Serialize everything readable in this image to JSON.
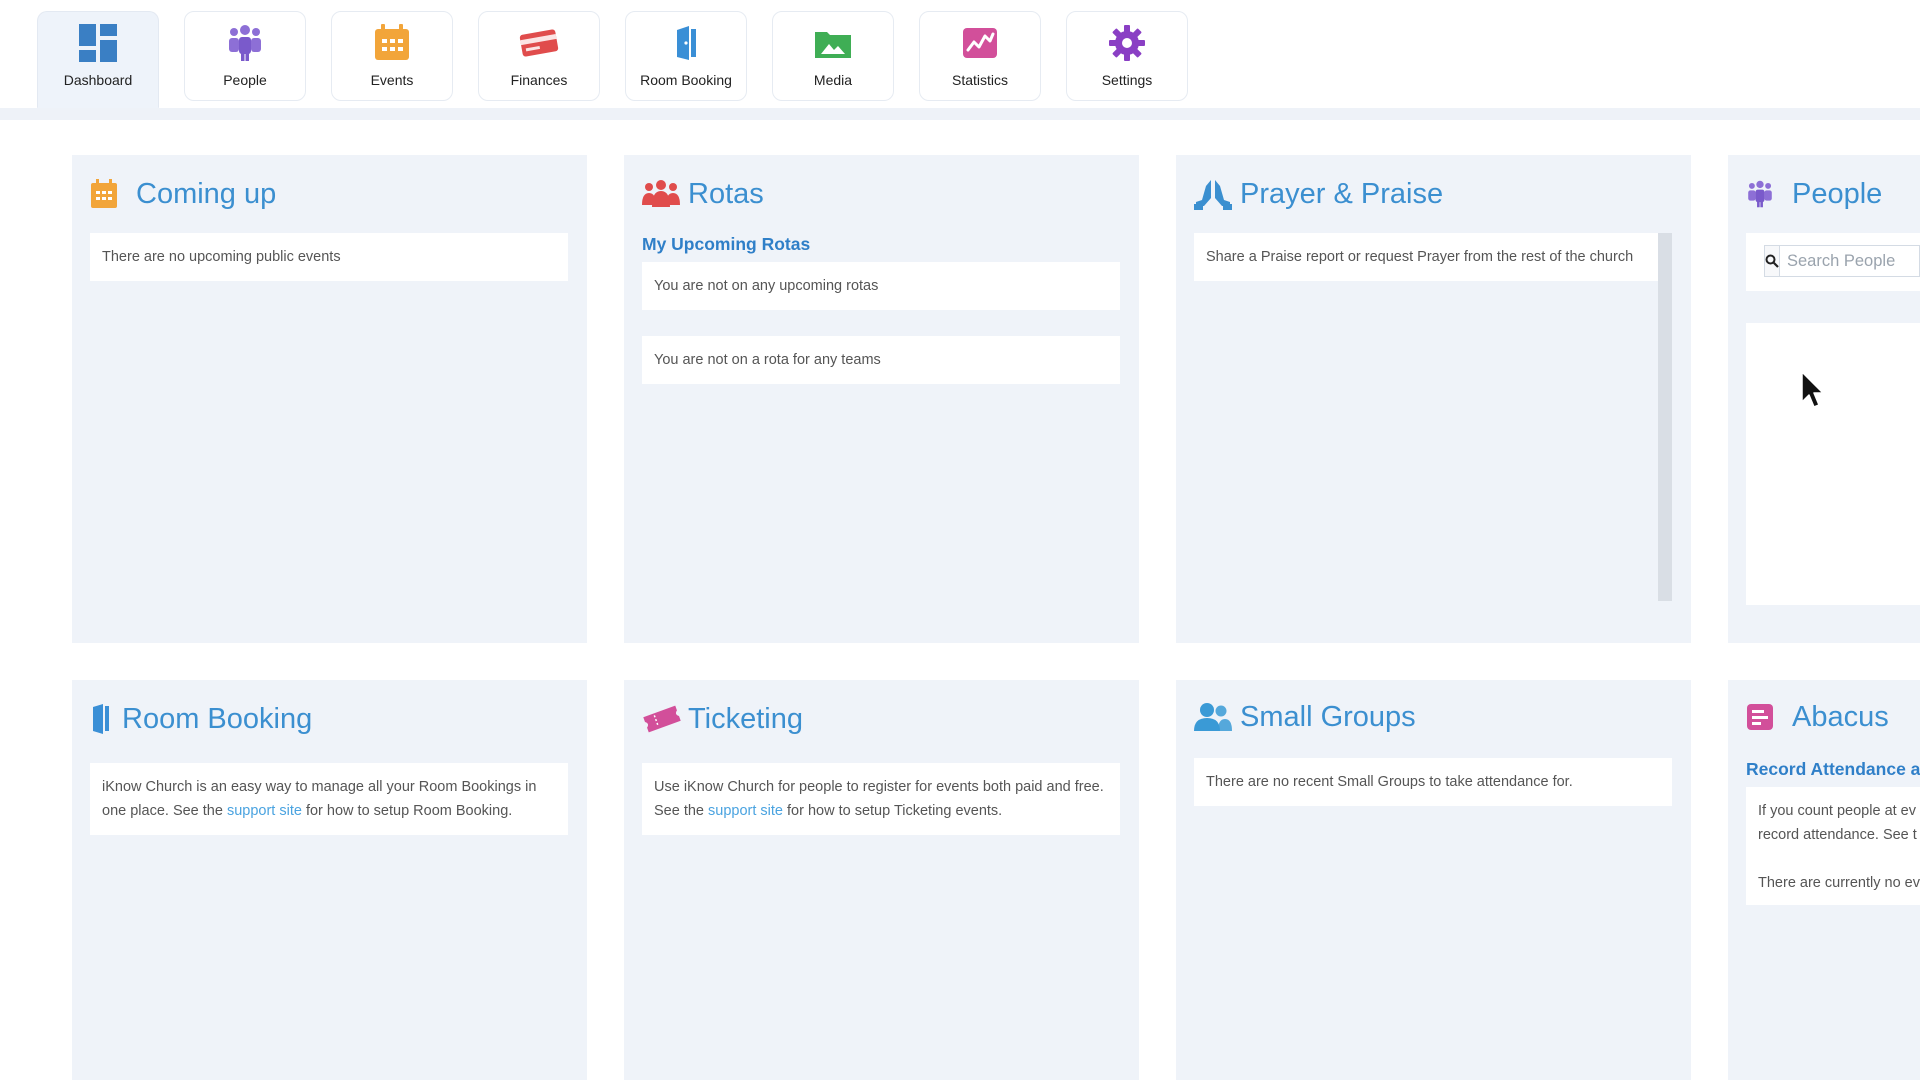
{
  "nav": {
    "items": [
      {
        "label": "Dashboard",
        "icon": "dashboard-icon",
        "active": true
      },
      {
        "label": "People",
        "icon": "people-icon"
      },
      {
        "label": "Events",
        "icon": "calendar-icon"
      },
      {
        "label": "Finances",
        "icon": "credit-card-icon"
      },
      {
        "label": "Room Booking",
        "icon": "door-icon"
      },
      {
        "label": "Media",
        "icon": "image-folder-icon"
      },
      {
        "label": "Statistics",
        "icon": "chart-icon"
      },
      {
        "label": "Settings",
        "icon": "gear-icon"
      }
    ]
  },
  "panels": {
    "coming_up": {
      "title": "Coming up",
      "message": "There are no upcoming public events"
    },
    "rotas": {
      "title": "Rotas",
      "subheading": "My Upcoming Rotas",
      "message_rotas": "You are not on any upcoming rotas",
      "message_teams": "You are not on a rota for any teams"
    },
    "prayer": {
      "title": "Prayer & Praise",
      "message": "Share a Praise report or request Prayer from the rest of the church"
    },
    "people": {
      "title": "People",
      "search_placeholder": "Search People"
    },
    "room_booking": {
      "title": "Room Booking",
      "text_before": "iKnow Church is an easy way to manage all your Room Bookings in one place. See the ",
      "link": "support site",
      "text_after": " for how to setup Room Booking."
    },
    "ticketing": {
      "title": "Ticketing",
      "text_before": "Use iKnow Church for people to register for events both paid and free. See the ",
      "link": "support site",
      "text_after": " for how to setup Ticketing events."
    },
    "small_groups": {
      "title": "Small Groups",
      "message": "There are no recent Small Groups to take attendance for."
    },
    "abacus": {
      "title": "Abacus",
      "subheading": "Record Attendance a",
      "text_line1": "If you count people at ev",
      "text_line2": "record attendance. See t",
      "text_line3": "There are currently no ev"
    }
  },
  "colors": {
    "accent_blue": "#3b8fd0",
    "link_blue": "#4aa3e0",
    "panel_bg": "#eff3f9"
  }
}
